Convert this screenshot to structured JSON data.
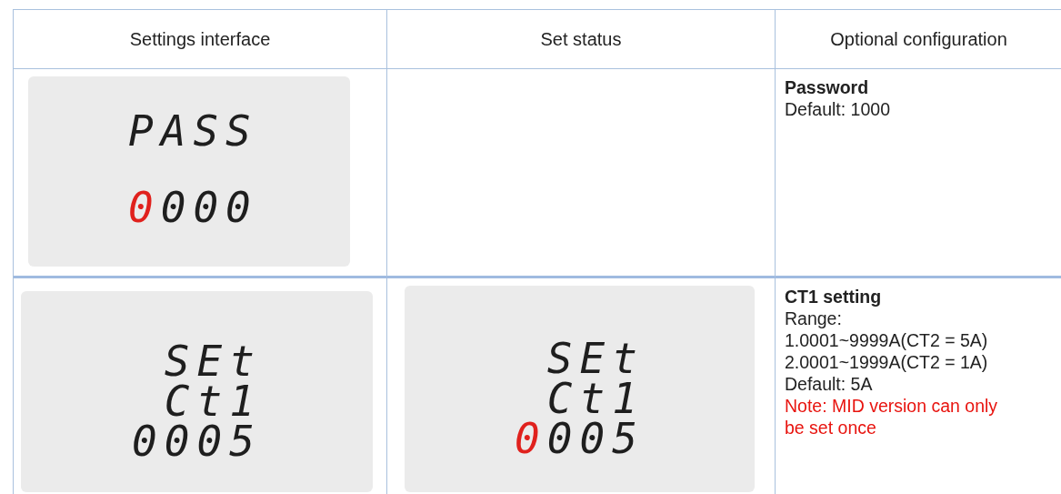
{
  "table": {
    "columns": [
      "Settings interface",
      "Set status",
      "Optional configuration"
    ],
    "rows": [
      {
        "settings_display": {
          "lines": [
            [
              {
                "text": "PASS",
                "highlighted": false
              }
            ],
            [
              {
                "text": "0",
                "highlighted": true
              },
              {
                "text": "000",
                "highlighted": false
              }
            ]
          ]
        },
        "configuration": {
          "title": "Password",
          "lines": [
            {
              "text": "Default: 1000",
              "kind": "normal"
            }
          ]
        }
      },
      {
        "settings_display": {
          "lines": [
            [
              {
                "text": "SEt",
                "highlighted": false
              }
            ],
            [
              {
                "text": "Ct1",
                "highlighted": false
              }
            ],
            [
              {
                "text": "0005",
                "highlighted": false
              }
            ]
          ]
        },
        "status_display": {
          "lines": [
            [
              {
                "text": "SEt",
                "highlighted": false
              }
            ],
            [
              {
                "text": "Ct1",
                "highlighted": false
              }
            ],
            [
              {
                "text": "0",
                "highlighted": true
              },
              {
                "text": "005",
                "highlighted": false
              }
            ]
          ]
        },
        "configuration": {
          "title": "CT1 setting",
          "lines": [
            {
              "text": "Range:",
              "kind": "normal"
            },
            {
              "text": "1.0001~9999A(CT2 = 5A)",
              "kind": "normal"
            },
            {
              "text": "2.0001~1999A(CT2 = 1A)",
              "kind": "normal"
            },
            {
              "text": "Default: 5A",
              "kind": "normal"
            },
            {
              "text": "Note: MID version can only be set once",
              "kind": "note"
            }
          ]
        }
      }
    ]
  }
}
